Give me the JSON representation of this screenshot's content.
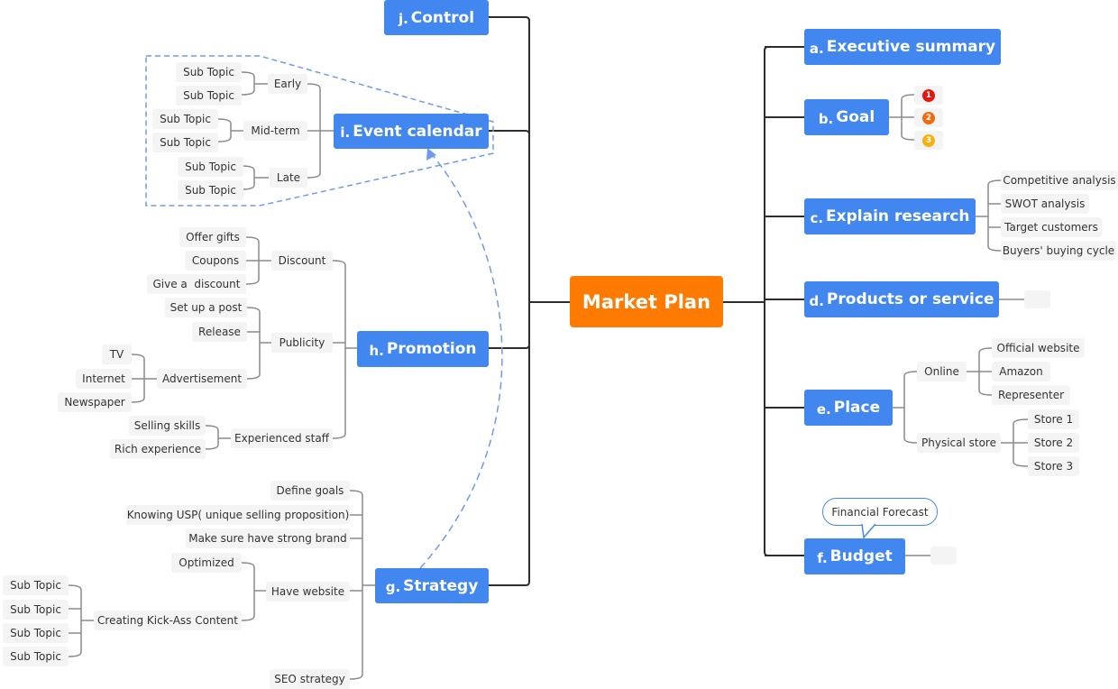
{
  "central": {
    "label": "Market Plan",
    "color": "#ff7a00"
  },
  "branch_color": "#4287f0",
  "branches": {
    "a": {
      "prefix": "a.",
      "label": "Executive summary"
    },
    "b": {
      "prefix": "b.",
      "label": "Goal",
      "markers": [
        {
          "label": "1",
          "color": "#e5150c"
        },
        {
          "label": "2",
          "color": "#f26a0f"
        },
        {
          "label": "3",
          "color": "#f5b311"
        }
      ]
    },
    "c": {
      "prefix": "c.",
      "label": "Explain research",
      "children": [
        "Competitive analysis",
        "SWOT analysis",
        "Target customers",
        "Buyers' buying cycle"
      ]
    },
    "d": {
      "prefix": "d.",
      "label": "Products or service",
      "children": [
        ""
      ]
    },
    "e": {
      "prefix": "e.",
      "label": "Place",
      "online": {
        "label": "Online",
        "children": [
          "Official website",
          "Amazon",
          "Representer"
        ]
      },
      "physical": {
        "label": "Physical store",
        "children": [
          "Store 1",
          "Store 2",
          "Store 3"
        ]
      }
    },
    "f": {
      "prefix": "f.",
      "label": "Budget",
      "callout": "Financial Forecast",
      "children": [
        ""
      ]
    },
    "g": {
      "prefix": "g.",
      "label": "Strategy",
      "items": [
        "Define goals",
        "Knowing USP( unique selling proposition)",
        "Make sure have strong brand"
      ],
      "website": {
        "label": "Have website",
        "optimized": "Optimized",
        "content": {
          "label": "Creating Kick-Ass Content",
          "children": [
            "Sub Topic",
            "Sub Topic",
            "Sub Topic",
            "Sub Topic"
          ]
        }
      },
      "seo": "SEO strategy"
    },
    "h": {
      "prefix": "h.",
      "label": "Promotion",
      "discount": {
        "label": "Discount",
        "children": [
          "Offer gifts",
          "Coupons",
          "Give a  discount"
        ]
      },
      "publicity": {
        "label": "Publicity",
        "children": [
          "Set up a post",
          "Release"
        ],
        "advertisement": {
          "label": "Advertisement",
          "children": [
            "TV",
            "Internet",
            "Newspaper"
          ]
        }
      },
      "staff": {
        "label": "Experienced staff",
        "children": [
          "Selling skills",
          "Rich experience"
        ]
      }
    },
    "i": {
      "prefix": "i.",
      "label": "Event calendar",
      "early": {
        "label": "Early",
        "children": [
          "Sub Topic",
          "Sub Topic"
        ]
      },
      "mid": {
        "label": "Mid-term",
        "children": [
          "Sub Topic",
          "Sub Topic"
        ]
      },
      "late": {
        "label": "Late",
        "children": [
          "Sub Topic",
          "Sub Topic"
        ]
      }
    },
    "j": {
      "prefix": "j.",
      "label": "Control"
    }
  }
}
